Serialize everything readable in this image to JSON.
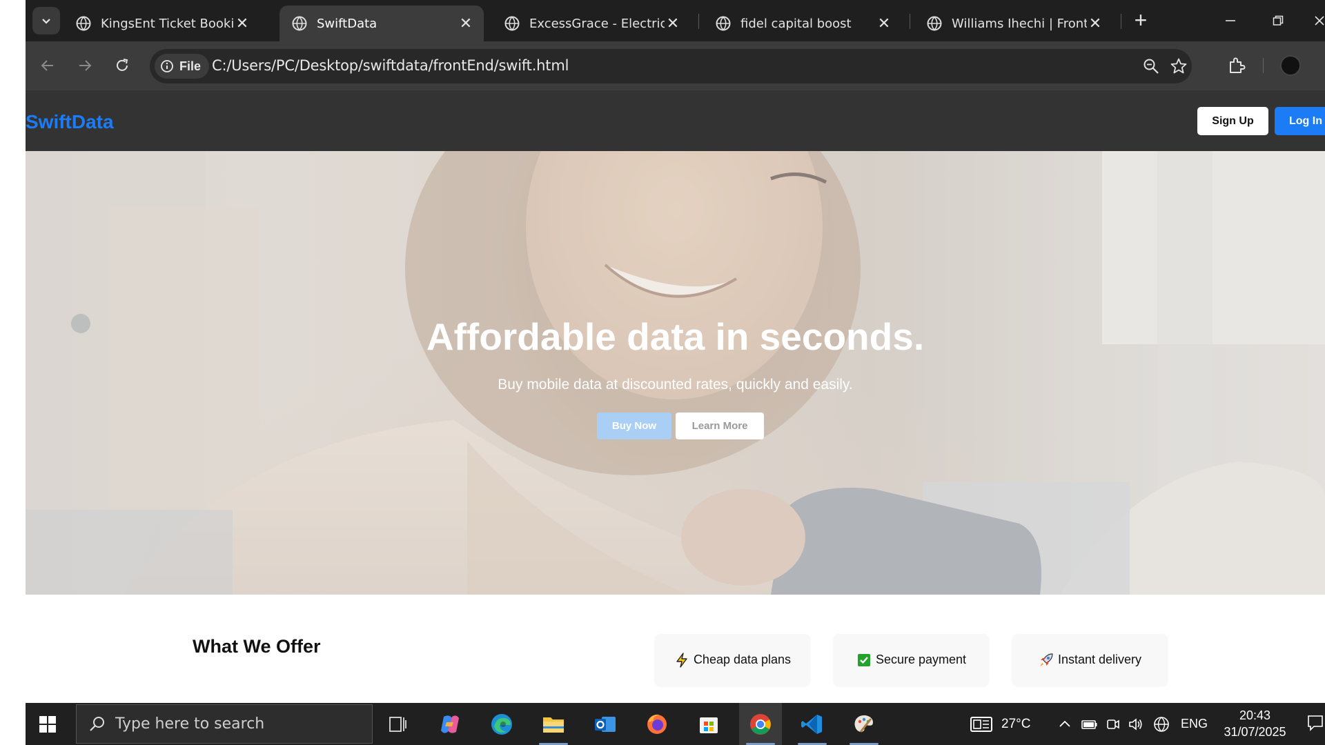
{
  "browser": {
    "tabs": [
      {
        "title": "KingsEnt Ticket Booking",
        "active": false
      },
      {
        "title": "SwiftData",
        "active": true
      },
      {
        "title": "ExcessGrace - Electrical S",
        "active": false
      },
      {
        "title": "fidel capital boost",
        "active": false
      },
      {
        "title": "Williams Ihechi | Front-En",
        "active": false
      }
    ],
    "omnibox": {
      "scheme_chip": "File",
      "url": "C:/Users/PC/Desktop/swiftdata/frontEnd/swift.html"
    }
  },
  "site": {
    "logo": "SwiftData",
    "nav": {
      "signup": "Sign Up",
      "login": "Log In"
    },
    "hero": {
      "title": "Affordable data in seconds.",
      "subtitle": "Buy mobile data at discounted rates, quickly and easily.",
      "buy_label": "Buy Now",
      "learn_label": "Learn More"
    },
    "offers": {
      "heading": "What We Offer",
      "cards": [
        {
          "icon": "lightning-icon",
          "label": "Cheap data plans"
        },
        {
          "icon": "check-box-icon",
          "label": "Secure payment"
        },
        {
          "icon": "rocket-icon",
          "label": "Instant delivery"
        }
      ]
    },
    "colors": {
      "brand": "#1b7cf5",
      "header_bg": "#333333"
    }
  },
  "taskbar": {
    "search_placeholder": "Type here to search",
    "weather": "27°C",
    "language": "ENG",
    "time": "20:43",
    "date": "31/07/2025"
  }
}
